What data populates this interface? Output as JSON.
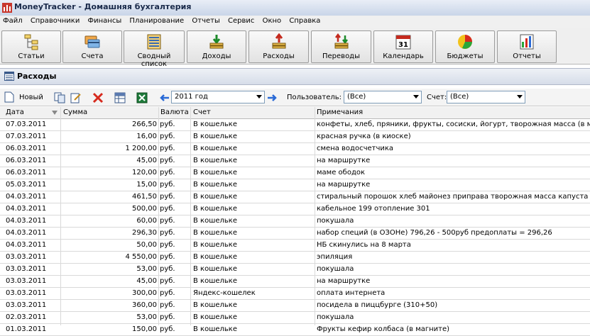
{
  "app": {
    "title": "MoneyTracker - Домашняя бухгалтерия"
  },
  "menu": [
    "Файл",
    "Справочники",
    "Финансы",
    "Планирование",
    "Отчеты",
    "Сервис",
    "Окно",
    "Справка"
  ],
  "toolbar": [
    {
      "label": "Статьи",
      "icon": "tree-icon"
    },
    {
      "label": "Счета",
      "icon": "cards-icon"
    },
    {
      "label": "Сводный список",
      "icon": "ledger-icon"
    },
    {
      "label": "Доходы",
      "icon": "income-icon"
    },
    {
      "label": "Расходы",
      "icon": "expense-icon"
    },
    {
      "label": "Переводы",
      "icon": "transfer-icon"
    },
    {
      "label": "Календарь",
      "icon": "calendar-icon"
    },
    {
      "label": "Бюджеты",
      "icon": "pie-icon"
    },
    {
      "label": "Отчеты",
      "icon": "bar-chart-icon"
    }
  ],
  "calendar_day": "31",
  "section": {
    "title": "Расходы"
  },
  "subbar": {
    "new_label": "Новый",
    "period": "2011 год",
    "user_label": "Пользователь:",
    "user_value": "(Все)",
    "account_label": "Счет:",
    "account_value": "(Все)"
  },
  "columns": {
    "date": "Дата",
    "amount": "Сумма",
    "currency": "Валюта",
    "account": "Счет",
    "notes": "Примечания"
  },
  "rows": [
    {
      "date": "07.03.2011",
      "amount": "266,50",
      "currency": "руб.",
      "account": "В кошельке",
      "notes": "конфеты, хлеб, пряники, фрукты, сосиски, йогурт, творожная масса (в магните)"
    },
    {
      "date": "07.03.2011",
      "amount": "16,00",
      "currency": "руб.",
      "account": "В кошельке",
      "notes": "красная ручка (в киоске)"
    },
    {
      "date": "06.03.2011",
      "amount": "1 200,00",
      "currency": "руб.",
      "account": "В кошельке",
      "notes": "смена водосчетчика"
    },
    {
      "date": "06.03.2011",
      "amount": "45,00",
      "currency": "руб.",
      "account": "В кошельке",
      "notes": "на маршрутке"
    },
    {
      "date": "06.03.2011",
      "amount": "120,00",
      "currency": "руб.",
      "account": "В кошельке",
      "notes": "маме ободок"
    },
    {
      "date": "05.03.2011",
      "amount": "15,00",
      "currency": "руб.",
      "account": "В кошельке",
      "notes": "на маршрутке"
    },
    {
      "date": "04.03.2011",
      "amount": "461,50",
      "currency": "руб.",
      "account": "В кошельке",
      "notes": "стиральный порошок хлеб майонез приправа творожная масса капуста"
    },
    {
      "date": "04.03.2011",
      "amount": "500,00",
      "currency": "руб.",
      "account": "В кошельке",
      "notes": "кабельное 199 отопление 301"
    },
    {
      "date": "04.03.2011",
      "amount": "60,00",
      "currency": "руб.",
      "account": "В кошельке",
      "notes": "покушала"
    },
    {
      "date": "04.03.2011",
      "amount": "296,30",
      "currency": "руб.",
      "account": "В кошельке",
      "notes": "набор специй (в ОЗОНе) 796,26 - 500руб предоплаты = 296,26"
    },
    {
      "date": "04.03.2011",
      "amount": "50,00",
      "currency": "руб.",
      "account": "В кошельке",
      "notes": "НБ скинулись на 8 марта"
    },
    {
      "date": "03.03.2011",
      "amount": "4 550,00",
      "currency": "руб.",
      "account": "В кошельке",
      "notes": "эпиляция"
    },
    {
      "date": "03.03.2011",
      "amount": "53,00",
      "currency": "руб.",
      "account": "В кошельке",
      "notes": "покушала"
    },
    {
      "date": "03.03.2011",
      "amount": "45,00",
      "currency": "руб.",
      "account": "В кошельке",
      "notes": "на маршрутке"
    },
    {
      "date": "03.03.2011",
      "amount": "300,00",
      "currency": "руб.",
      "account": "Яндекс-кошелек",
      "notes": "оплата интернета"
    },
    {
      "date": "03.03.2011",
      "amount": "360,00",
      "currency": "руб.",
      "account": "В кошельке",
      "notes": "посидела в пиццбурге (310+50)"
    },
    {
      "date": "02.03.2011",
      "amount": "53,00",
      "currency": "руб.",
      "account": "В кошельке",
      "notes": "покушала"
    },
    {
      "date": "01.03.2011",
      "amount": "150,00",
      "currency": "руб.",
      "account": "В кошельке",
      "notes": "Фрукты кефир колбаса (в магните)"
    }
  ]
}
